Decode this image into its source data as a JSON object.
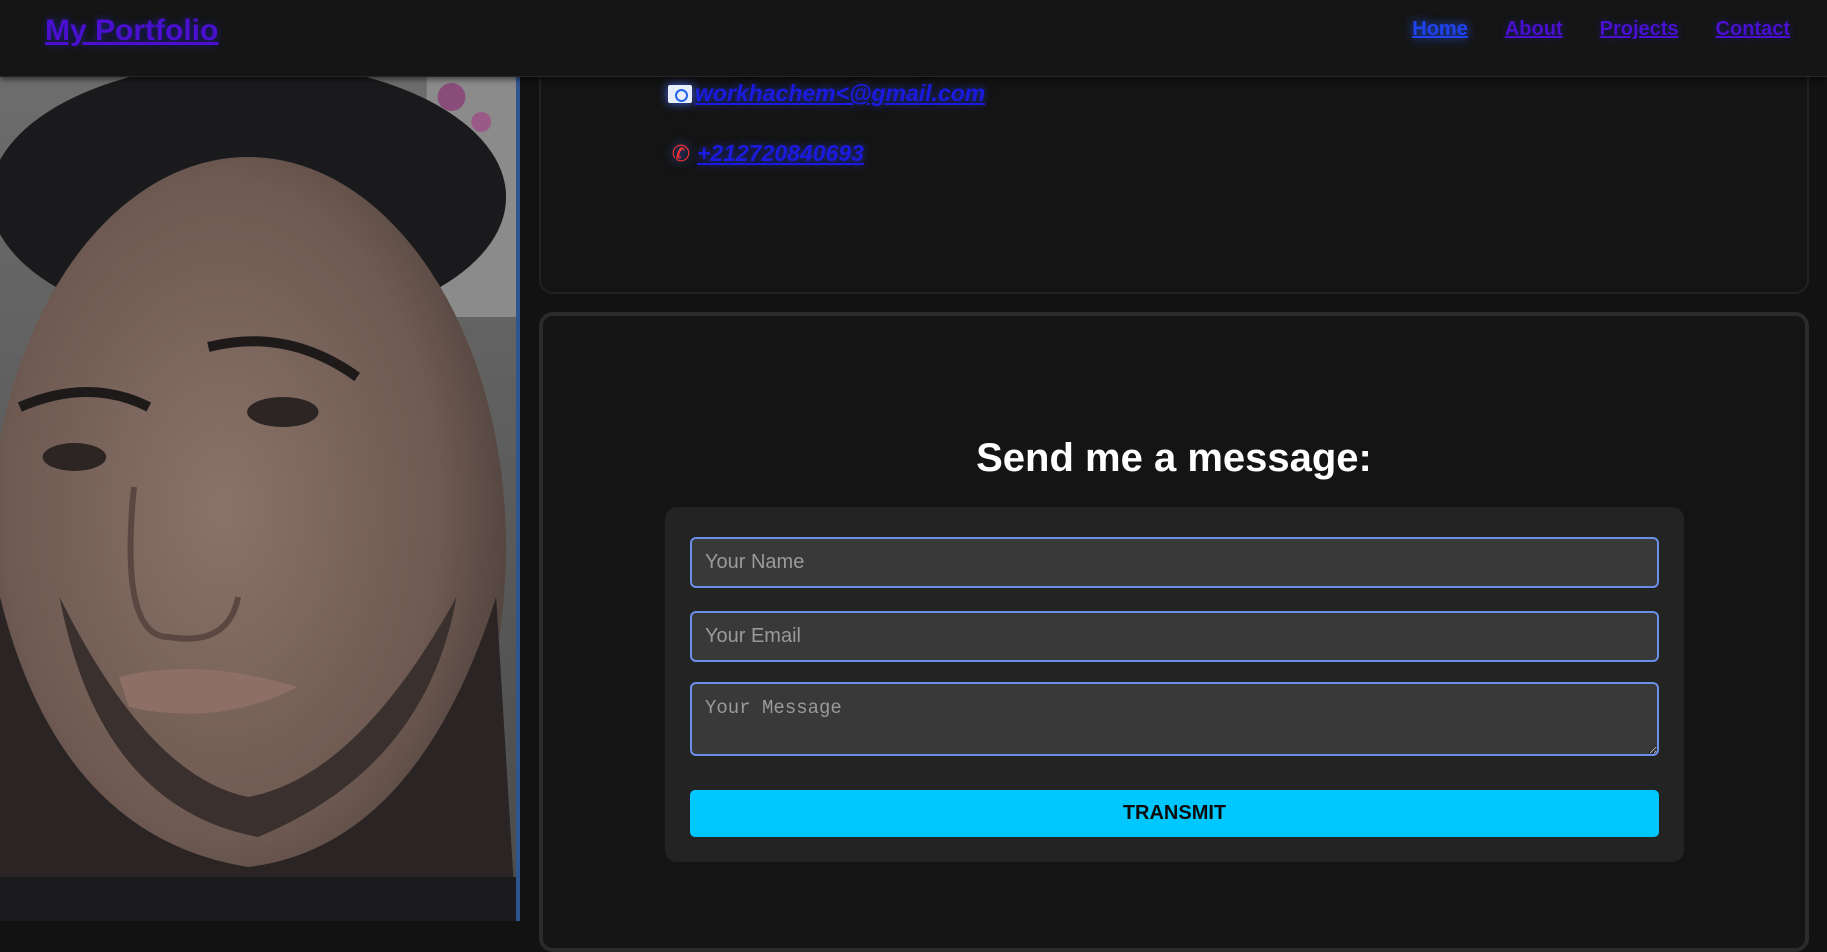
{
  "nav": {
    "logo": "My Portfolio",
    "links": [
      {
        "label": "Home",
        "active": true
      },
      {
        "label": "About",
        "active": false
      },
      {
        "label": "Projects",
        "active": false
      },
      {
        "label": "Contact",
        "active": false
      }
    ]
  },
  "profile": {
    "photo_icon": "portrait-photo"
  },
  "contact": {
    "email": {
      "icon": "envelope-icon",
      "text": "workhachem<@gmail.com"
    },
    "phone": {
      "icon": "phone-icon",
      "text": "+212720840693"
    }
  },
  "form": {
    "title": "Send me a message:",
    "name_placeholder": "Your Name",
    "email_placeholder": "Your Email",
    "message_placeholder": "Your Message",
    "submit_label": "TRANSMIT"
  },
  "colors": {
    "accent_button": "#00c8ff",
    "nav_link": "#4b0fd0",
    "input_border": "#6a8fe8"
  }
}
